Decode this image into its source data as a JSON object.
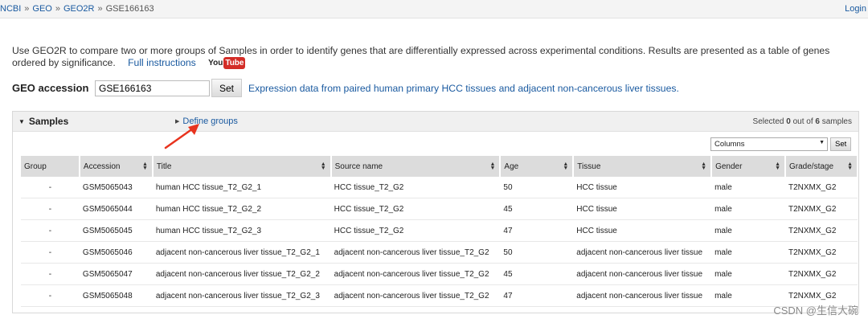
{
  "breadcrumb": {
    "items": [
      "NCBI",
      "GEO",
      "GEO2R"
    ],
    "separator": "»",
    "current": "GSE166163"
  },
  "login_label": "Login",
  "intro": {
    "text": "Use GEO2R to compare two or more groups of Samples in order to identify genes that are differentially expressed across experimental conditions. Results are presented as a table of genes ordered by significance.",
    "full_instructions": "Full instructions",
    "youtube_you": "You",
    "youtube_tube": "Tube"
  },
  "accession": {
    "label": "GEO accession",
    "value": "GSE166163",
    "set_label": "Set",
    "description": "Expression data from paired human primary HCC tissues and adjacent non-cancerous liver tissues."
  },
  "samples_panel": {
    "title": "Samples",
    "define_groups": "Define groups",
    "selected_prefix": "Selected",
    "selected_count": "0",
    "selected_middle": "out of",
    "total_count": "6",
    "selected_suffix": "samples",
    "columns_select": "Columns",
    "columns_set": "Set"
  },
  "table": {
    "headers": [
      "Group",
      "Accession",
      "Title",
      "Source name",
      "Age",
      "Tissue",
      "Gender",
      "Grade/stage"
    ],
    "rows": [
      [
        "-",
        "GSM5065043",
        "human HCC tissue_T2_G2_1",
        "HCC tissue_T2_G2",
        "50",
        "HCC tissue",
        "male",
        "T2NXMX_G2"
      ],
      [
        "-",
        "GSM5065044",
        "human HCC tissue_T2_G2_2",
        "HCC tissue_T2_G2",
        "45",
        "HCC tissue",
        "male",
        "T2NXMX_G2"
      ],
      [
        "-",
        "GSM5065045",
        "human HCC tissue_T2_G2_3",
        "HCC tissue_T2_G2",
        "47",
        "HCC tissue",
        "male",
        "T2NXMX_G2"
      ],
      [
        "-",
        "GSM5065046",
        "adjacent non-cancerous liver tissue_T2_G2_1",
        "adjacent non-cancerous liver tissue_T2_G2",
        "50",
        "adjacent non-cancerous liver tissue",
        "male",
        "T2NXMX_G2"
      ],
      [
        "-",
        "GSM5065047",
        "adjacent non-cancerous liver tissue_T2_G2_2",
        "adjacent non-cancerous liver tissue_T2_G2",
        "45",
        "adjacent non-cancerous liver tissue",
        "male",
        "T2NXMX_G2"
      ],
      [
        "-",
        "GSM5065048",
        "adjacent non-cancerous liver tissue_T2_G2_3",
        "adjacent non-cancerous liver tissue_T2_G2",
        "47",
        "adjacent non-cancerous liver tissue",
        "male",
        "T2NXMX_G2"
      ]
    ]
  },
  "annotation": {
    "arrow_color": "#e8331e",
    "icon": "red-arrow-icon"
  },
  "watermark": "CSDN @生信大碗",
  "colors": {
    "link": "#1a5aa0",
    "header_bg": "#dcdcdc",
    "panel_head_bg": "#f0f0f0"
  }
}
